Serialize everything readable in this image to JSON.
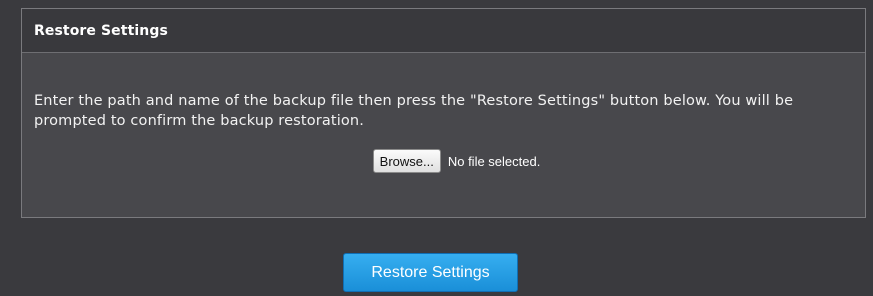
{
  "panel": {
    "title": "Restore Settings",
    "description": "Enter the path and name of the backup file then press the \"Restore Settings\" button below. You will be prompted to confirm the backup restoration."
  },
  "file_input": {
    "button_label": "Browse...",
    "status": "No file selected."
  },
  "actions": {
    "restore_label": "Restore Settings"
  },
  "colors": {
    "page_background": "#3a3a3e",
    "panel_background": "#48484c",
    "header_background": "#39393d",
    "accent_button": "#1a8fd8"
  }
}
